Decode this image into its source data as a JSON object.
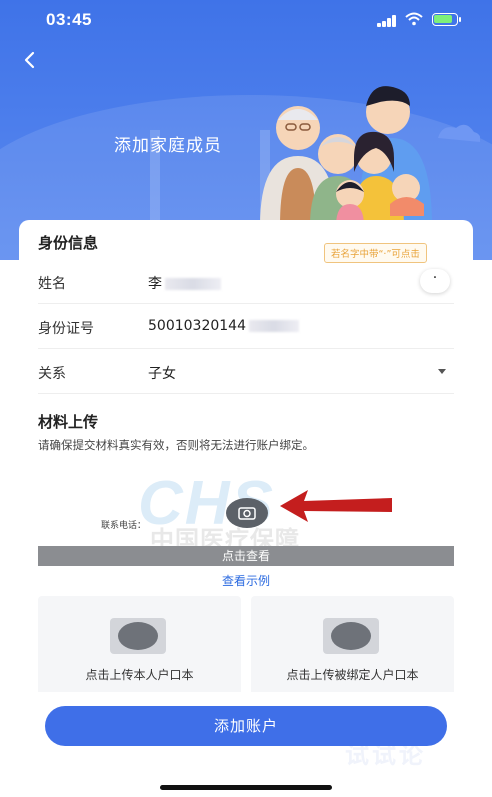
{
  "status_bar": {
    "time": "03:45"
  },
  "header": {
    "title": "添加家庭成员",
    "back_icon": "chevron-left-icon"
  },
  "identity_section": {
    "title": "身份信息",
    "hint_tag": "若名字中带“·”可点击",
    "fields": [
      {
        "label": "姓名",
        "value": "李",
        "action_symbol": "·"
      },
      {
        "label": "身份证号",
        "value": "50010320144"
      },
      {
        "label": "关系",
        "value": "子女"
      }
    ]
  },
  "upload_section": {
    "title": "材料上传",
    "note": "请确保提交材料真实有效，否则将无法进行账户绑定。",
    "sample": {
      "phone_label": "联系电话：",
      "view_label": "点击查看"
    },
    "example_link": "查看示例",
    "tiles": [
      {
        "label": "点击上传本人户口本",
        "icon": "camera-icon"
      },
      {
        "label": "点击上传被绑定人户口本",
        "icon": "camera-icon"
      }
    ]
  },
  "submit_label": "添加账户",
  "colors": {
    "primary": "#3f6fe8",
    "hint": "#e8a33a",
    "link": "#2c6be0",
    "arrow": "#c41e1e"
  }
}
